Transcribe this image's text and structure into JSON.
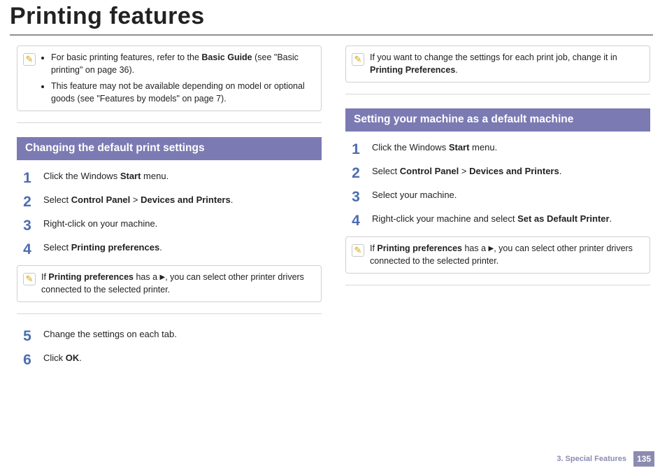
{
  "title": "Printing features",
  "footer": {
    "chapter": "3.  Special Features",
    "page": "135"
  },
  "left": {
    "top_note": {
      "bullets": [
        {
          "pre": "For basic printing features, refer to the ",
          "b1": "Basic Guide",
          "mid": " (see \"Basic printing\" on page 36)."
        },
        {
          "pre": "This feature may not be available depending on model or optional goods (see \"Features by models\" on page 7).",
          "b1": "",
          "mid": ""
        }
      ]
    },
    "section_title": "Changing the default print settings",
    "steps": [
      {
        "n": "1",
        "pre": "Click the Windows ",
        "b1": "Start",
        "post": " menu."
      },
      {
        "n": "2",
        "pre": "Select ",
        "b1": "Control Panel",
        "mid": " > ",
        "b2": "Devices and Printers",
        "post": "."
      },
      {
        "n": "3",
        "pre": "Right-click on your machine."
      },
      {
        "n": "4",
        "pre": "Select ",
        "b1": "Printing preferences",
        "post": "."
      }
    ],
    "mid_note": {
      "pre": "If ",
      "b1": "Printing preferences",
      "mid": " has a ",
      "tri": "▶",
      "post": ", you can select other printer drivers connected to the selected printer."
    },
    "steps2": [
      {
        "n": "5",
        "pre": "Change the settings on each tab."
      },
      {
        "n": "6",
        "pre": "Click ",
        "b1": "OK",
        "post": "."
      }
    ]
  },
  "right": {
    "top_note": {
      "pre": "If you want to change the settings for each print job, change it in ",
      "b1": "Printing Preferences",
      "post": "."
    },
    "section_title": "Setting your machine as a default machine",
    "steps": [
      {
        "n": "1",
        "pre": "Click the Windows ",
        "b1": "Start",
        "post": " menu."
      },
      {
        "n": "2",
        "pre": "Select ",
        "b1": "Control Panel",
        "mid": " > ",
        "b2": "Devices and Printers",
        "post": "."
      },
      {
        "n": "3",
        "pre": "Select your machine."
      },
      {
        "n": "4",
        "pre": "Right-click your machine and select ",
        "b1": "Set as Default Printer",
        "post": "."
      }
    ],
    "mid_note": {
      "pre": "If ",
      "b1": "Printing preferences",
      "mid": " has a ",
      "tri": "▶",
      "post": ", you can select other printer drivers connected to the selected printer."
    }
  }
}
